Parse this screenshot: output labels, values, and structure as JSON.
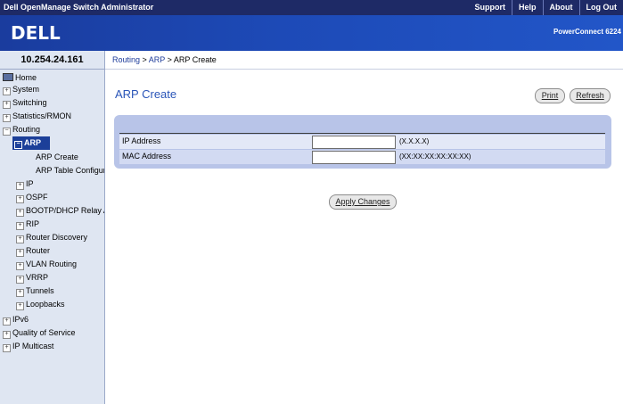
{
  "topbar": {
    "title": "Dell OpenManage Switch Administrator",
    "links": [
      "Support",
      "Help",
      "About",
      "Log Out"
    ]
  },
  "banner": {
    "logo": "DELL",
    "product": "PowerConnect 6224"
  },
  "sidebar": {
    "ip": "10.254.24.161",
    "items": [
      "Home",
      "System",
      "Switching",
      "Statistics/RMON",
      "Routing",
      "ARP",
      "ARP Create",
      "ARP Table Configuration",
      "IP",
      "OSPF",
      "BOOTP/DHCP Relay Agent",
      "RIP",
      "Router Discovery",
      "Router",
      "VLAN Routing",
      "VRRP",
      "Tunnels",
      "Loopbacks",
      "IPv6",
      "Quality of Service",
      "IP Multicast"
    ]
  },
  "breadcrumb": {
    "routing": "Routing",
    "sep": " > ",
    "arp": "ARP",
    "current": "ARP Create"
  },
  "page": {
    "title": "ARP Create",
    "print_label": "Print",
    "refresh_label": "Refresh",
    "apply_label": "Apply Changes"
  },
  "form": {
    "ip_label": "IP Address",
    "ip_value": "",
    "ip_hint": "(X.X.X.X)",
    "mac_label": "MAC Address",
    "mac_value": "",
    "mac_hint": "(XX:XX:XX:XX:XX:XX)"
  },
  "colors": {
    "header_bar": "#1e2a66",
    "banner": "#1d4ab7",
    "sidebar_bg": "#dfe6f2",
    "selected": "#1c3f99",
    "form_panel": "#b8c4e8",
    "title": "#2a55b8"
  }
}
